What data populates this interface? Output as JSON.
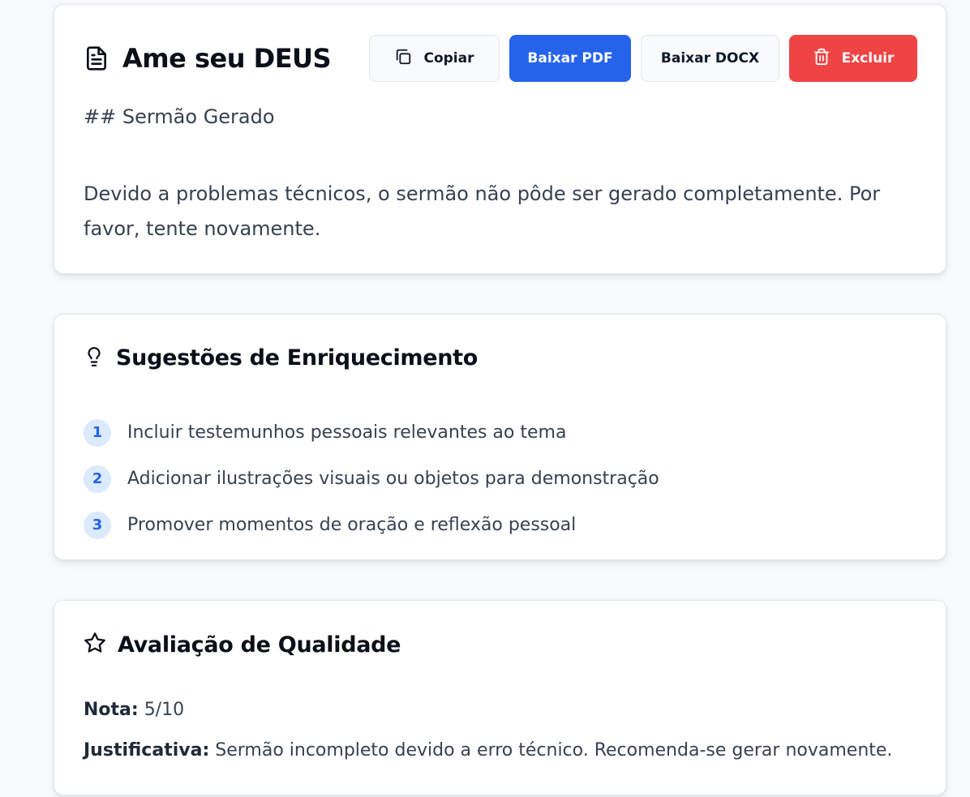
{
  "sermon": {
    "title": "Ame seu DEUS",
    "title_icon": "document-icon",
    "heading": "## Sermão Gerado",
    "body": "Devido a problemas técnicos, o sermão não pôde ser gerado completamente. Por favor, tente novamente."
  },
  "actions": {
    "copy_label": "Copiar",
    "copy_icon": "copy-icon",
    "pdf_label": "Baixar PDF",
    "docx_label": "Baixar DOCX",
    "delete_label": "Excluir",
    "delete_icon": "trash-icon"
  },
  "suggestions": {
    "title": "Sugestões de Enriquecimento",
    "icon": "lightbulb-icon",
    "items": [
      {
        "number": "1",
        "text": "Incluir testemunhos pessoais relevantes ao tema"
      },
      {
        "number": "2",
        "text": "Adicionar ilustrações visuais ou objetos para demonstração"
      },
      {
        "number": "3",
        "text": "Promover momentos de oração e reflexão pessoal"
      }
    ]
  },
  "quality": {
    "title": "Avaliação de Qualidade",
    "icon": "star-icon",
    "score_label": "Nota:",
    "score_value": "5/10",
    "justification_label": "Justificativa:",
    "justification_value": "Sermão incompleto devido a erro técnico. Recomenda-se gerar novamente."
  },
  "colors": {
    "primary": "#2563eb",
    "danger": "#ef4444",
    "badge_bg": "#dbeafe",
    "page_bg": "#f8fafc"
  }
}
